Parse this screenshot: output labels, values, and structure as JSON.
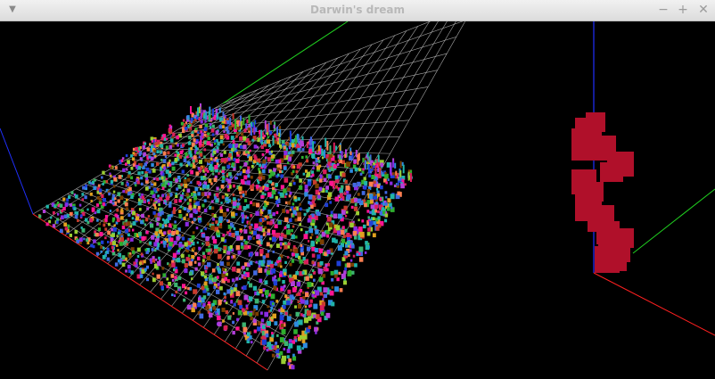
{
  "window": {
    "title": "Darwin's dream",
    "menu_icon": "chevron-down-icon",
    "controls": {
      "minimize": "−",
      "maximize": "+",
      "close": "✕"
    }
  },
  "views": {
    "world_view": {
      "description": "3D world view with colorful agents on a grid",
      "grid_color": "#ffffff"
    },
    "creature_view": {
      "description": "3D view of a single creature",
      "creature_color": "#b0102a"
    }
  },
  "colors": {
    "axis_x": "#ff2020",
    "axis_y": "#20d020",
    "axis_z": "#2030ff",
    "agents": [
      "#d81e5b",
      "#1e3fd8",
      "#22b5a8",
      "#b23fd8",
      "#e0a020",
      "#2fae2f",
      "#c83c2c",
      "#2e8be0",
      "#9acd32",
      "#8a2be2",
      "#ff7f50",
      "#20b2aa",
      "#ff1493",
      "#4169e1",
      "#7b3f00",
      "#3cb371"
    ]
  }
}
